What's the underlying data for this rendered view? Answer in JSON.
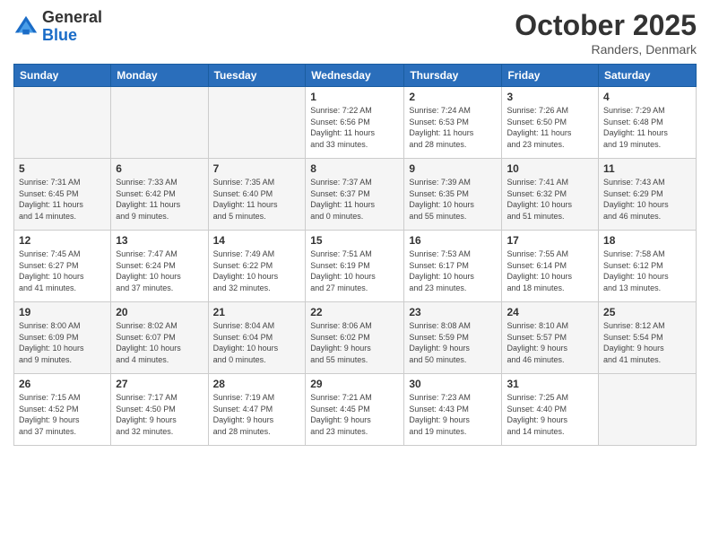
{
  "logo": {
    "general": "General",
    "blue": "Blue"
  },
  "title": "October 2025",
  "location": "Randers, Denmark",
  "days_header": [
    "Sunday",
    "Monday",
    "Tuesday",
    "Wednesday",
    "Thursday",
    "Friday",
    "Saturday"
  ],
  "weeks": [
    [
      {
        "day": "",
        "info": ""
      },
      {
        "day": "",
        "info": ""
      },
      {
        "day": "",
        "info": ""
      },
      {
        "day": "1",
        "info": "Sunrise: 7:22 AM\nSunset: 6:56 PM\nDaylight: 11 hours\nand 33 minutes."
      },
      {
        "day": "2",
        "info": "Sunrise: 7:24 AM\nSunset: 6:53 PM\nDaylight: 11 hours\nand 28 minutes."
      },
      {
        "day": "3",
        "info": "Sunrise: 7:26 AM\nSunset: 6:50 PM\nDaylight: 11 hours\nand 23 minutes."
      },
      {
        "day": "4",
        "info": "Sunrise: 7:29 AM\nSunset: 6:48 PM\nDaylight: 11 hours\nand 19 minutes."
      }
    ],
    [
      {
        "day": "5",
        "info": "Sunrise: 7:31 AM\nSunset: 6:45 PM\nDaylight: 11 hours\nand 14 minutes."
      },
      {
        "day": "6",
        "info": "Sunrise: 7:33 AM\nSunset: 6:42 PM\nDaylight: 11 hours\nand 9 minutes."
      },
      {
        "day": "7",
        "info": "Sunrise: 7:35 AM\nSunset: 6:40 PM\nDaylight: 11 hours\nand 5 minutes."
      },
      {
        "day": "8",
        "info": "Sunrise: 7:37 AM\nSunset: 6:37 PM\nDaylight: 11 hours\nand 0 minutes."
      },
      {
        "day": "9",
        "info": "Sunrise: 7:39 AM\nSunset: 6:35 PM\nDaylight: 10 hours\nand 55 minutes."
      },
      {
        "day": "10",
        "info": "Sunrise: 7:41 AM\nSunset: 6:32 PM\nDaylight: 10 hours\nand 51 minutes."
      },
      {
        "day": "11",
        "info": "Sunrise: 7:43 AM\nSunset: 6:29 PM\nDaylight: 10 hours\nand 46 minutes."
      }
    ],
    [
      {
        "day": "12",
        "info": "Sunrise: 7:45 AM\nSunset: 6:27 PM\nDaylight: 10 hours\nand 41 minutes."
      },
      {
        "day": "13",
        "info": "Sunrise: 7:47 AM\nSunset: 6:24 PM\nDaylight: 10 hours\nand 37 minutes."
      },
      {
        "day": "14",
        "info": "Sunrise: 7:49 AM\nSunset: 6:22 PM\nDaylight: 10 hours\nand 32 minutes."
      },
      {
        "day": "15",
        "info": "Sunrise: 7:51 AM\nSunset: 6:19 PM\nDaylight: 10 hours\nand 27 minutes."
      },
      {
        "day": "16",
        "info": "Sunrise: 7:53 AM\nSunset: 6:17 PM\nDaylight: 10 hours\nand 23 minutes."
      },
      {
        "day": "17",
        "info": "Sunrise: 7:55 AM\nSunset: 6:14 PM\nDaylight: 10 hours\nand 18 minutes."
      },
      {
        "day": "18",
        "info": "Sunrise: 7:58 AM\nSunset: 6:12 PM\nDaylight: 10 hours\nand 13 minutes."
      }
    ],
    [
      {
        "day": "19",
        "info": "Sunrise: 8:00 AM\nSunset: 6:09 PM\nDaylight: 10 hours\nand 9 minutes."
      },
      {
        "day": "20",
        "info": "Sunrise: 8:02 AM\nSunset: 6:07 PM\nDaylight: 10 hours\nand 4 minutes."
      },
      {
        "day": "21",
        "info": "Sunrise: 8:04 AM\nSunset: 6:04 PM\nDaylight: 10 hours\nand 0 minutes."
      },
      {
        "day": "22",
        "info": "Sunrise: 8:06 AM\nSunset: 6:02 PM\nDaylight: 9 hours\nand 55 minutes."
      },
      {
        "day": "23",
        "info": "Sunrise: 8:08 AM\nSunset: 5:59 PM\nDaylight: 9 hours\nand 50 minutes."
      },
      {
        "day": "24",
        "info": "Sunrise: 8:10 AM\nSunset: 5:57 PM\nDaylight: 9 hours\nand 46 minutes."
      },
      {
        "day": "25",
        "info": "Sunrise: 8:12 AM\nSunset: 5:54 PM\nDaylight: 9 hours\nand 41 minutes."
      }
    ],
    [
      {
        "day": "26",
        "info": "Sunrise: 7:15 AM\nSunset: 4:52 PM\nDaylight: 9 hours\nand 37 minutes."
      },
      {
        "day": "27",
        "info": "Sunrise: 7:17 AM\nSunset: 4:50 PM\nDaylight: 9 hours\nand 32 minutes."
      },
      {
        "day": "28",
        "info": "Sunrise: 7:19 AM\nSunset: 4:47 PM\nDaylight: 9 hours\nand 28 minutes."
      },
      {
        "day": "29",
        "info": "Sunrise: 7:21 AM\nSunset: 4:45 PM\nDaylight: 9 hours\nand 23 minutes."
      },
      {
        "day": "30",
        "info": "Sunrise: 7:23 AM\nSunset: 4:43 PM\nDaylight: 9 hours\nand 19 minutes."
      },
      {
        "day": "31",
        "info": "Sunrise: 7:25 AM\nSunset: 4:40 PM\nDaylight: 9 hours\nand 14 minutes."
      },
      {
        "day": "",
        "info": ""
      }
    ]
  ]
}
